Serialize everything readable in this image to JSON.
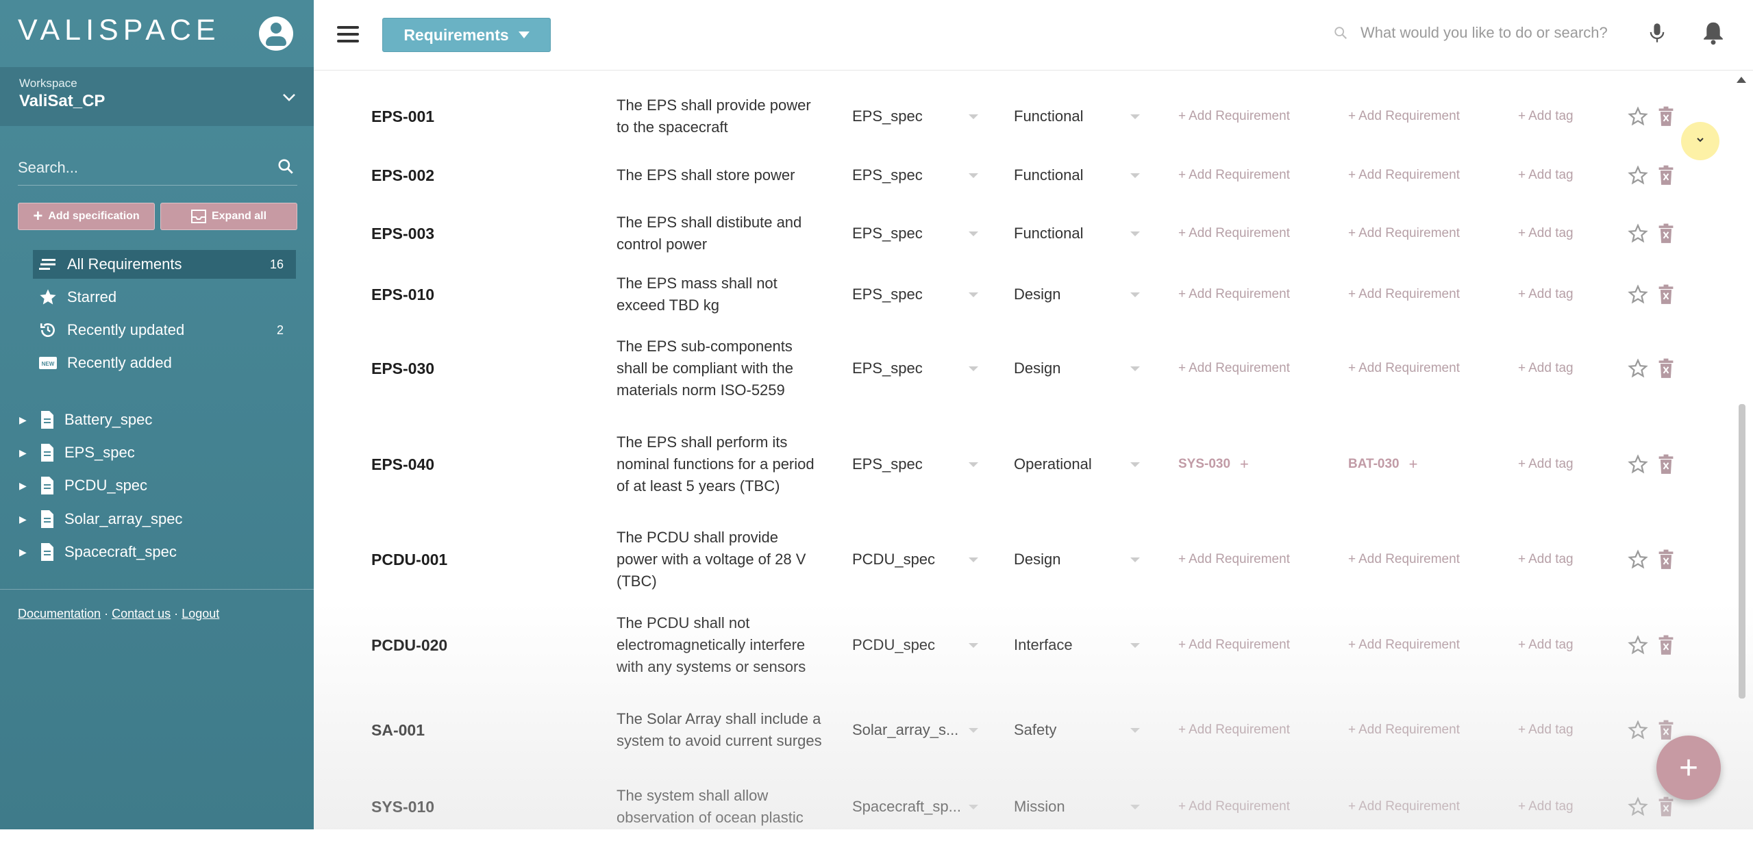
{
  "app": {
    "logo": "VALISPACE"
  },
  "workspace": {
    "label": "Workspace",
    "name": "ValiSat_CP"
  },
  "sidebar": {
    "search_placeholder": "Search...",
    "add_spec_label": "Add specification",
    "expand_all_label": "Expand all",
    "nav": [
      {
        "label": "All Requirements",
        "count": "16"
      },
      {
        "label": "Starred",
        "count": ""
      },
      {
        "label": "Recently updated",
        "count": "2"
      },
      {
        "label": "Recently added",
        "count": ""
      }
    ],
    "specs": [
      "Battery_spec",
      "EPS_spec",
      "PCDU_spec",
      "Solar_array_spec",
      "Spacecraft_spec"
    ],
    "footer": {
      "documentation": "Documentation",
      "contact": "Contact us",
      "logout": "Logout",
      "sep": "·"
    }
  },
  "topbar": {
    "module_label": "Requirements",
    "search_placeholder": "What would you like to do or search?"
  },
  "table": {
    "add_requirement": "Add Requirement",
    "add_tag": "Add tag",
    "rows": [
      {
        "id": "EPS-001",
        "text": "The EPS shall provide power to the spacecraft",
        "spec": "EPS_spec",
        "type": "Functional",
        "parent": "",
        "child": ""
      },
      {
        "id": "EPS-002",
        "text": "The EPS shall store power",
        "spec": "EPS_spec",
        "type": "Functional",
        "parent": "",
        "child": ""
      },
      {
        "id": "EPS-003",
        "text": "The EPS shall distibute and control power",
        "spec": "EPS_spec",
        "type": "Functional",
        "parent": "",
        "child": ""
      },
      {
        "id": "EPS-010",
        "text": "The EPS mass shall not exceed TBD kg",
        "spec": "EPS_spec",
        "type": "Design",
        "parent": "",
        "child": ""
      },
      {
        "id": "EPS-030",
        "text": "The EPS sub-components shall be compliant with the materials norm ISO-5259",
        "spec": "EPS_spec",
        "type": "Design",
        "parent": "",
        "child": ""
      },
      {
        "id": "EPS-040",
        "text": "The EPS shall perform its nominal functions for a period of at least 5 years (TBC)",
        "spec": "EPS_spec",
        "type": "Operational",
        "parent": "SYS-030",
        "child": "BAT-030"
      },
      {
        "id": "PCDU-001",
        "text": "The PCDU shall provide power with a voltage of 28 V (TBC)",
        "spec": "PCDU_spec",
        "type": "Design",
        "parent": "",
        "child": ""
      },
      {
        "id": "PCDU-020",
        "text": "The PCDU shall not electromagnetically interfere with any systems or sensors",
        "spec": "PCDU_spec",
        "type": "Interface",
        "parent": "",
        "child": ""
      },
      {
        "id": "SA-001",
        "text": "The Solar Array shall include a system to avoid current surges",
        "spec": "Solar_array_s...",
        "type": "Safety",
        "parent": "",
        "child": ""
      },
      {
        "id": "SYS-010",
        "text": "The system shall allow observation of ocean plastic",
        "spec": "Spacecraft_sp...",
        "type": "Mission",
        "parent": "",
        "child": ""
      }
    ]
  },
  "colors": {
    "sidebar": "#4a8a99",
    "accent": "#6ab2c4",
    "pink": "#c79aa3"
  }
}
